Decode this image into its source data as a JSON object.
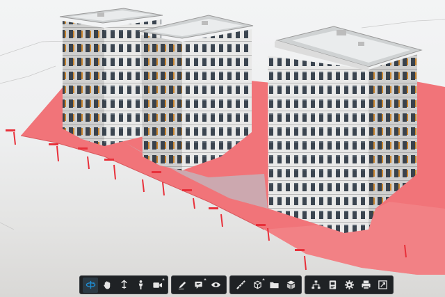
{
  "app": {
    "view": "3D model viewer",
    "accent_color": "#1f8fd6",
    "toolbar_bg": "#1f2225",
    "terrain_color": "#f2787c",
    "marker_color": "#e8303a"
  },
  "toolbar": {
    "groups": [
      {
        "name": "navigation",
        "tools": [
          {
            "icon": "orbit-icon",
            "active": true,
            "has_submenu": false
          },
          {
            "icon": "pan-hand-icon",
            "active": false,
            "has_submenu": false
          },
          {
            "icon": "zoom-updown-icon",
            "active": false,
            "has_submenu": false
          },
          {
            "icon": "first-person-icon",
            "active": false,
            "has_submenu": false
          },
          {
            "icon": "camera-icon",
            "active": false,
            "has_submenu": true
          }
        ]
      },
      {
        "name": "markup",
        "tools": [
          {
            "icon": "markup-pen-icon",
            "active": false,
            "has_submenu": false
          },
          {
            "icon": "comment-icon",
            "active": false,
            "has_submenu": true
          },
          {
            "icon": "visibility-eye-icon",
            "active": false,
            "has_submenu": false
          }
        ]
      },
      {
        "name": "model",
        "tools": [
          {
            "icon": "measure-icon",
            "active": false,
            "has_submenu": false
          },
          {
            "icon": "section-box-icon",
            "active": false,
            "has_submenu": true
          },
          {
            "icon": "folder-icon",
            "active": false,
            "has_submenu": false
          },
          {
            "icon": "explode-cube-icon",
            "active": false,
            "has_submenu": false
          }
        ]
      },
      {
        "name": "settings",
        "tools": [
          {
            "icon": "model-tree-icon",
            "active": false,
            "has_submenu": false
          },
          {
            "icon": "properties-icon",
            "active": false,
            "has_submenu": false
          },
          {
            "icon": "settings-gear-icon",
            "active": false,
            "has_submenu": false
          },
          {
            "icon": "print-icon",
            "active": false,
            "has_submenu": false
          },
          {
            "icon": "fullscreen-icon",
            "active": false,
            "has_submenu": false
          }
        ]
      }
    ]
  }
}
